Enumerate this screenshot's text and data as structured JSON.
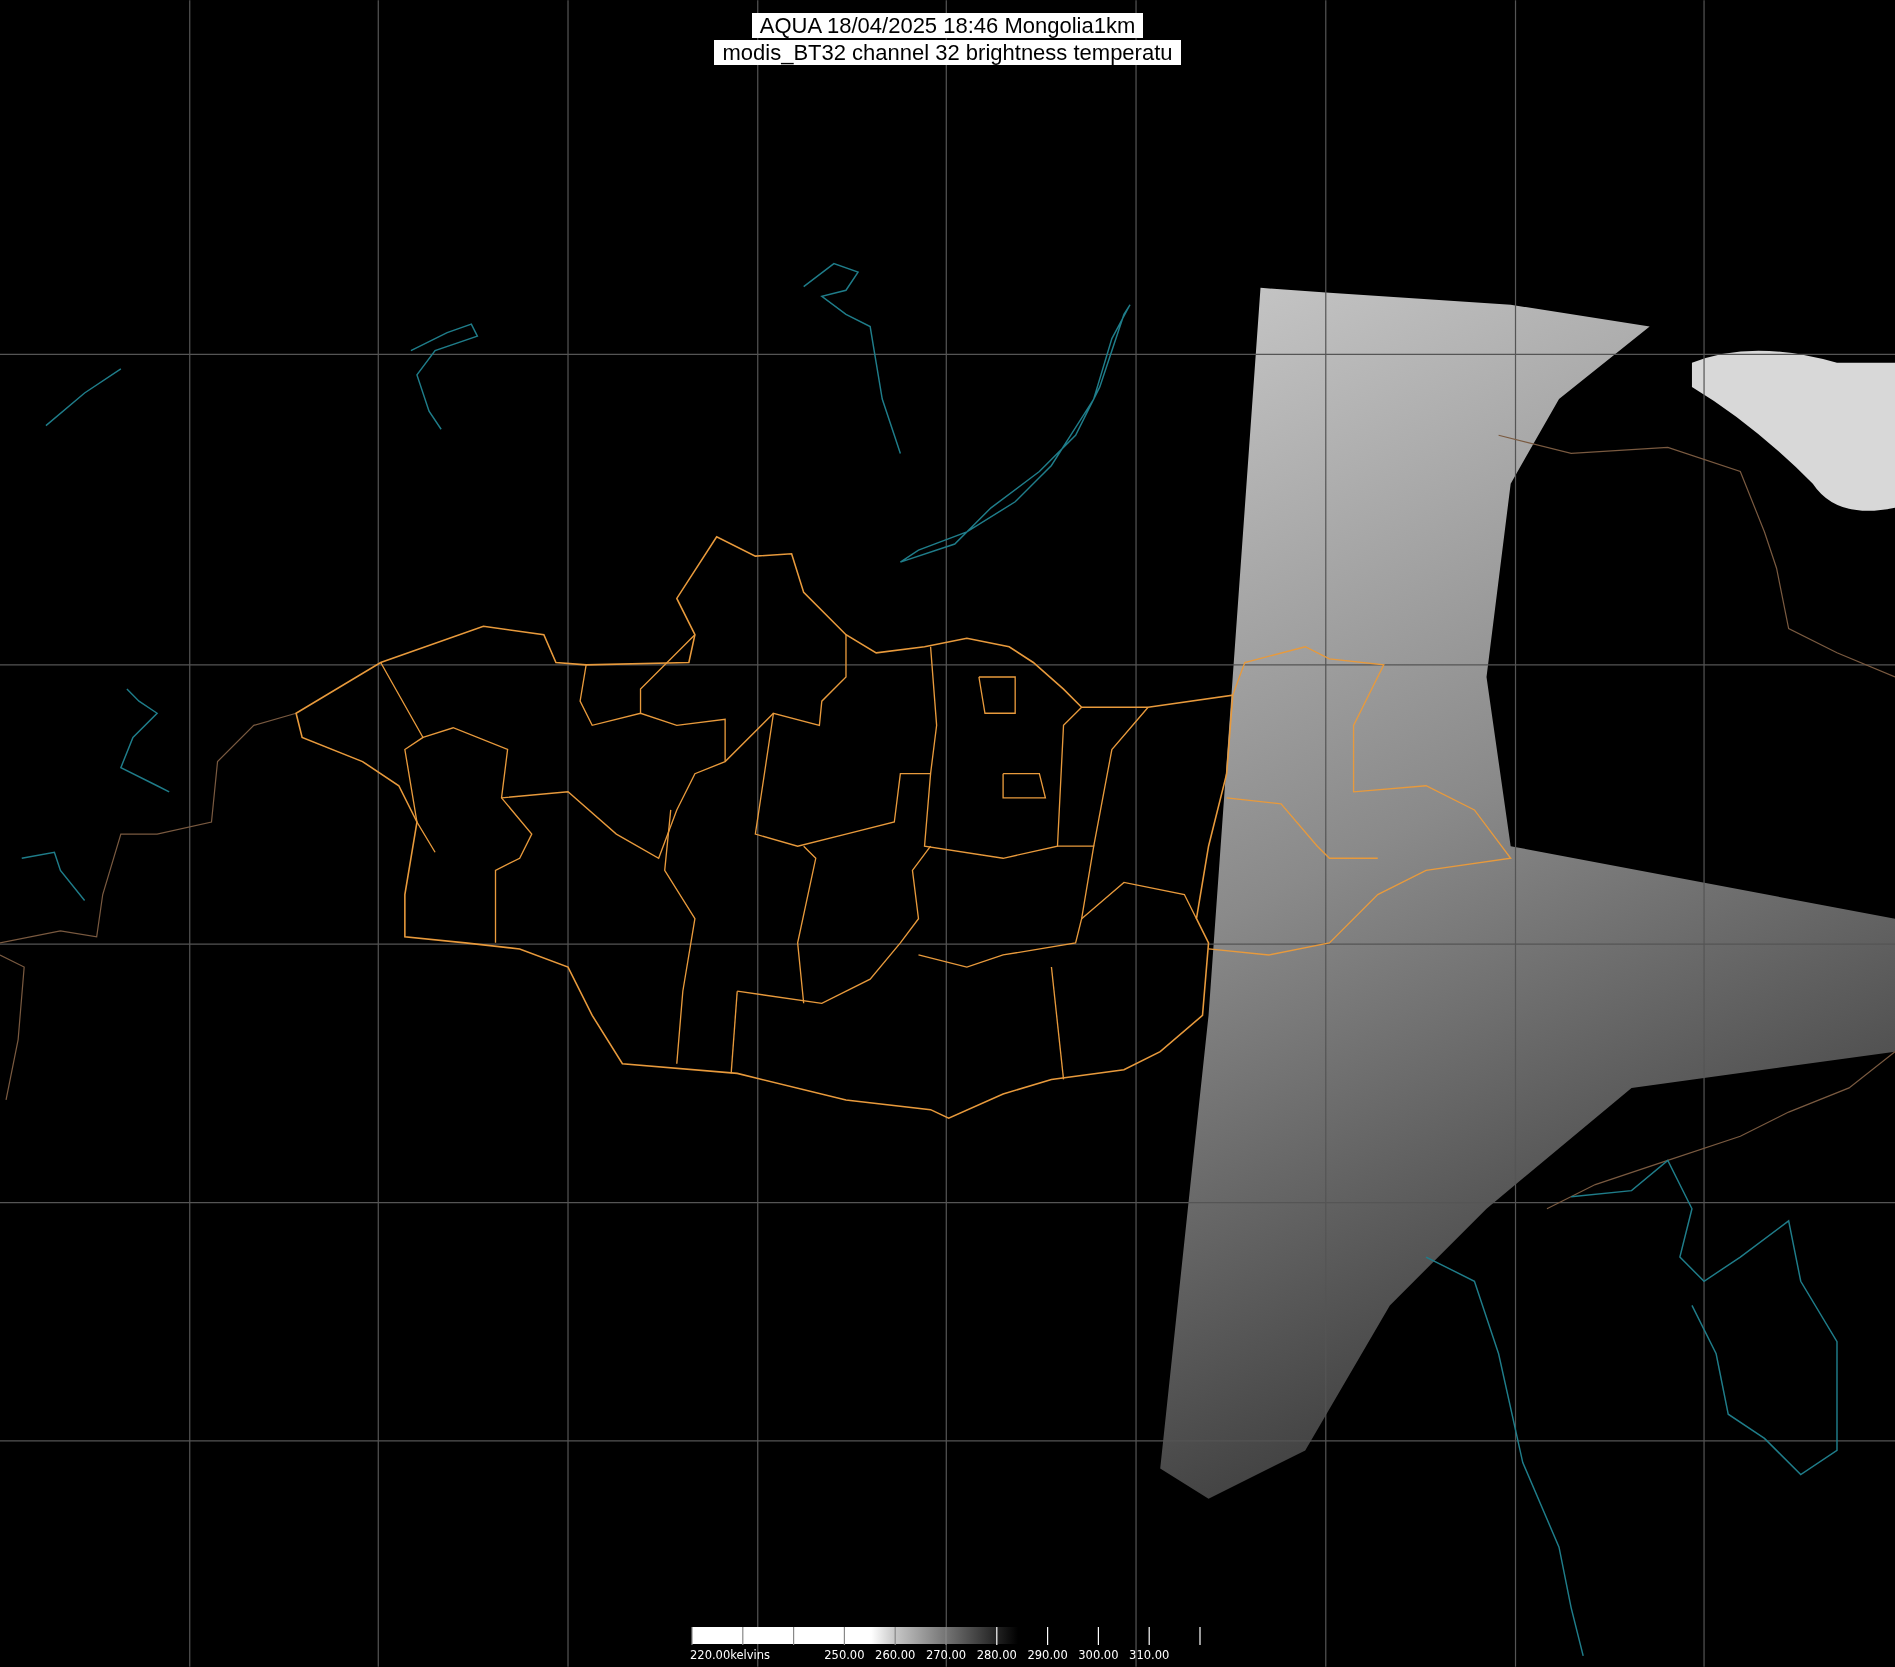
{
  "title": {
    "lines": [
      "AQUA 18/04/2025 18:46 Mongolia1km",
      "modis_BT32 channel 32 brightness temperatu"
    ]
  },
  "colorbar": {
    "labels": [
      "220.00kelvins",
      "250.00",
      "260.00",
      "270.00",
      "280.00",
      "290.00",
      "300.00",
      "310.00"
    ]
  }
}
